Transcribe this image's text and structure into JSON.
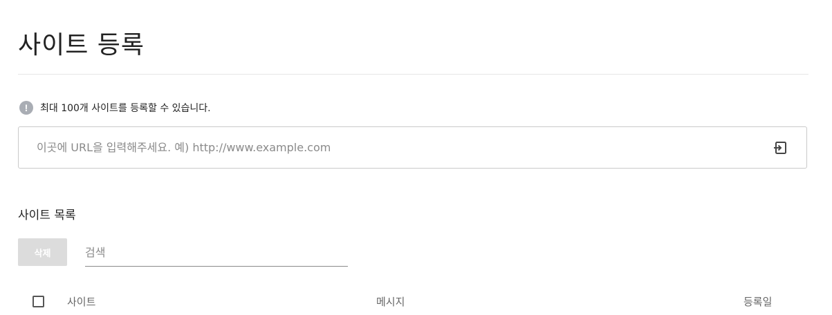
{
  "header": {
    "title": "사이트 등록"
  },
  "notice": {
    "icon": "info-icon",
    "icon_glyph": "!",
    "text": "최대 100개 사이트를 등록할 수 있습니다."
  },
  "url_field": {
    "value": "",
    "placeholder": "이곳에 URL을 입력해주세요. 예) http://www.example.com",
    "submit_icon": "enter-icon"
  },
  "site_list": {
    "title": "사이트 목록",
    "delete_label": "삭제",
    "search_placeholder": "검색",
    "search_value": "",
    "columns": {
      "site": "사이트",
      "message": "메시지",
      "date": "등록일"
    },
    "select_all_checked": false
  },
  "colors": {
    "divider": "#e6e6e6",
    "notice_icon": "#a9adb4",
    "disabled_button": "#dcdcdc",
    "border": "#c9c9c9"
  }
}
